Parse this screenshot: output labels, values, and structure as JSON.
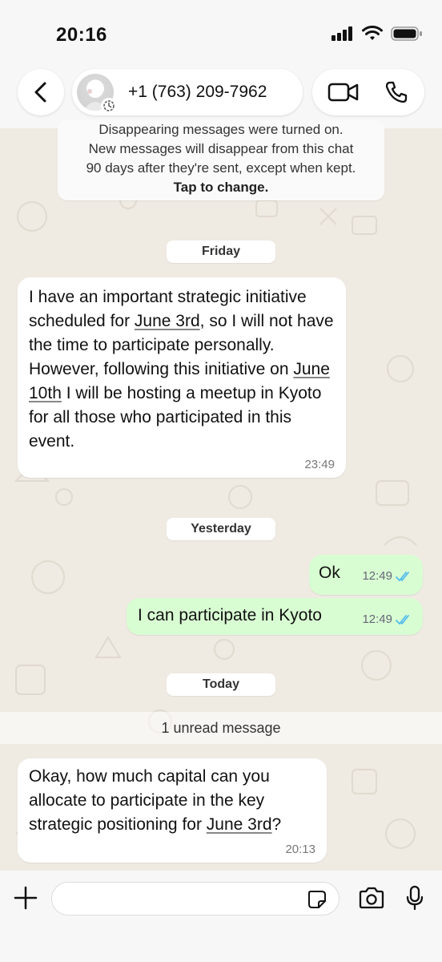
{
  "status_bar": {
    "time": "20:16"
  },
  "header": {
    "contact_name": "+1 (763) 209-7962"
  },
  "system_notice": {
    "line1": "Disappearing messages were turned on.",
    "line2": "New messages will disappear from this chat",
    "line3": "90 days after they're sent, except when kept.",
    "action": "Tap to change."
  },
  "dates": {
    "friday": "Friday",
    "yesterday": "Yesterday",
    "today": "Today"
  },
  "messages": {
    "m1": {
      "p1": "I have an important strategic initiative scheduled for ",
      "link1": "June 3rd",
      "p2": ", so I will not have the time to participate personally. However, following this initiative on ",
      "link2": "June 10th",
      "p3": " I will be hosting a meetup in Kyoto for all those who participated in this event.",
      "time": "23:49"
    },
    "m2": {
      "text": "Ok",
      "time": "12:49"
    },
    "m3": {
      "text": "I can participate in Kyoto",
      "time": "12:49"
    },
    "m4": {
      "p1": "Okay, how much capital can you allocate to participate in the key strategic positioning for ",
      "link1": "June 3rd",
      "p2": "?",
      "time": "20:13"
    }
  },
  "unread": {
    "label": "1 unread message"
  },
  "input": {
    "placeholder": ""
  },
  "colors": {
    "outgoing_bubble": "#d9fdd3",
    "incoming_bubble": "#ffffff",
    "read_ticks": "#53bdeb",
    "chat_background": "#efeae2"
  },
  "icons": {
    "back": "chevron-left-icon",
    "video": "video-camera-icon",
    "phone": "phone-icon",
    "plus": "plus-icon",
    "sticker": "sticker-icon",
    "camera": "camera-icon",
    "mic": "microphone-icon",
    "read": "double-check-icon",
    "timer": "timer-icon"
  }
}
